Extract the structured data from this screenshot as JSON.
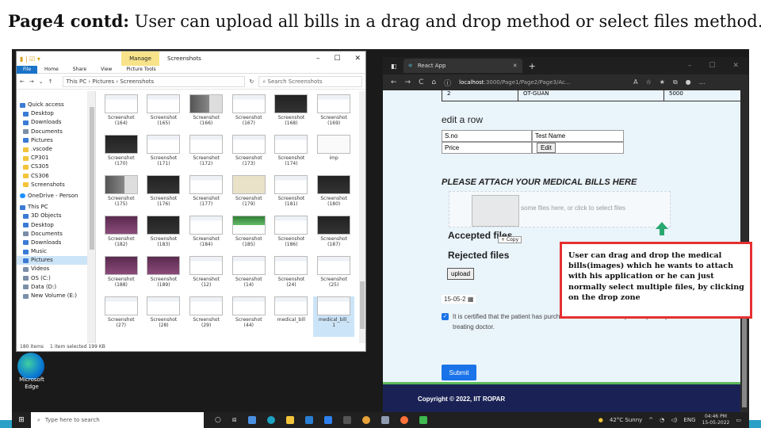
{
  "slide": {
    "title_bold": "Page4 contd:",
    "title_rest": " User can upload all bills in a drag and drop method or select files method."
  },
  "explorer": {
    "manage_tab": "Manage",
    "window_title": "Screenshots",
    "ribbon": [
      "File",
      "Home",
      "Share",
      "View",
      "Picture Tools"
    ],
    "path": "This PC  ›  Pictures  ›  Screenshots",
    "search_placeholder": "Search Screenshots",
    "nav": [
      {
        "label": "Quick access",
        "icon": "star"
      },
      {
        "label": "Desktop",
        "icon": "folder-blue"
      },
      {
        "label": "Downloads",
        "icon": "download"
      },
      {
        "label": "Documents",
        "icon": "documents"
      },
      {
        "label": "Pictures",
        "icon": "pictures"
      },
      {
        "label": ".vscode",
        "icon": "folder"
      },
      {
        "label": "CP301",
        "icon": "folder"
      },
      {
        "label": "CS305",
        "icon": "folder"
      },
      {
        "label": "CS306",
        "icon": "folder"
      },
      {
        "label": "Screenshots",
        "icon": "folder"
      },
      {
        "label": "OneDrive - Person",
        "icon": "cloud"
      },
      {
        "label": "This PC",
        "icon": "pc"
      },
      {
        "label": "3D Objects",
        "icon": "cube"
      },
      {
        "label": "Desktop",
        "icon": "folder-blue"
      },
      {
        "label": "Documents",
        "icon": "documents"
      },
      {
        "label": "Downloads",
        "icon": "download"
      },
      {
        "label": "Music",
        "icon": "music"
      },
      {
        "label": "Pictures",
        "icon": "pictures"
      },
      {
        "label": "Videos",
        "icon": "videos"
      },
      {
        "label": "OS (C:)",
        "icon": "drive"
      },
      {
        "label": "Data (D:)",
        "icon": "drive"
      },
      {
        "label": "New Volume (E:)",
        "icon": "drive"
      }
    ],
    "files": [
      {
        "l1": "Screenshot",
        "l2": "(164)",
        "t": ""
      },
      {
        "l1": "Screenshot",
        "l2": "(165)",
        "t": ""
      },
      {
        "l1": "Screenshot",
        "l2": "(166)",
        "t": "mid"
      },
      {
        "l1": "Screenshot",
        "l2": "(167)",
        "t": ""
      },
      {
        "l1": "Screenshot",
        "l2": "(168)",
        "t": "dark"
      },
      {
        "l1": "Screenshot",
        "l2": "(169)",
        "t": ""
      },
      {
        "l1": "Screenshot",
        "l2": "(170)",
        "t": "dark"
      },
      {
        "l1": "Screenshot",
        "l2": "(171)",
        "t": ""
      },
      {
        "l1": "Screenshot",
        "l2": "(172)",
        "t": ""
      },
      {
        "l1": "Screenshot",
        "l2": "(173)",
        "t": ""
      },
      {
        "l1": "Screenshot",
        "l2": "(174)",
        "t": ""
      },
      {
        "l1": "imp",
        "l2": "",
        "t": "blank"
      },
      {
        "l1": "Screenshot",
        "l2": "(175)",
        "t": "mid"
      },
      {
        "l1": "Screenshot",
        "l2": "(176)",
        "t": "dark"
      },
      {
        "l1": "Screenshot",
        "l2": "(177)",
        "t": ""
      },
      {
        "l1": "Screenshot",
        "l2": "(179)",
        "t": "paper"
      },
      {
        "l1": "Screenshot",
        "l2": "(181)",
        "t": ""
      },
      {
        "l1": "Screenshot",
        "l2": "(180)",
        "t": "dark"
      },
      {
        "l1": "Screenshot",
        "l2": "(182)",
        "t": "purple"
      },
      {
        "l1": "Screenshot",
        "l2": "(183)",
        "t": "dark"
      },
      {
        "l1": "Screenshot",
        "l2": "(184)",
        "t": ""
      },
      {
        "l1": "Screenshot",
        "l2": "(185)",
        "t": "green"
      },
      {
        "l1": "Screenshot",
        "l2": "(186)",
        "t": ""
      },
      {
        "l1": "Screenshot",
        "l2": "(187)",
        "t": "dark"
      },
      {
        "l1": "Screenshot",
        "l2": "(188)",
        "t": "purple"
      },
      {
        "l1": "Screenshot",
        "l2": "(189)",
        "t": "purple"
      },
      {
        "l1": "Screenshot",
        "l2": "(12)",
        "t": ""
      },
      {
        "l1": "Screenshot",
        "l2": "(14)",
        "t": ""
      },
      {
        "l1": "Screenshot",
        "l2": "(24)",
        "t": ""
      },
      {
        "l1": "Screenshot",
        "l2": "(25)",
        "t": ""
      },
      {
        "l1": "Screenshot",
        "l2": "(27)",
        "t": ""
      },
      {
        "l1": "Screenshot",
        "l2": "(28)",
        "t": ""
      },
      {
        "l1": "Screenshot",
        "l2": "(29)",
        "t": ""
      },
      {
        "l1": "Screenshot",
        "l2": "(44)",
        "t": ""
      },
      {
        "l1": "medical_bill",
        "l2": "",
        "t": ""
      },
      {
        "l1": "medical_bill_",
        "l2": "1",
        "t": "",
        "selected": true
      }
    ],
    "status": [
      "180 items",
      "1 item selected  199 KB"
    ]
  },
  "desktop_icon": "Microsoft Edge",
  "browser": {
    "tab_title": "React App",
    "url_host": "localhost",
    "url_rest": ":3000/Page1/Page2/Page3/Ac...",
    "table_partial": [
      "2",
      "OT-GUAN",
      "5000"
    ],
    "edit_row_title": "edit a row",
    "edit_table": {
      "sno_label": "S.no",
      "sno_value": "Test Name",
      "price_label": "Price",
      "edit_button": "Edit"
    },
    "attach_title": "PLEASE ATTACH YOUR MEDICAL BILLS HERE",
    "dropzone_text": "some files here, or click to select files",
    "accepted_label": "Accepted files",
    "copy_badge": "+ Copy",
    "rejected_label": "Rejected files",
    "upload_button": "upload",
    "date_value": "15-05-2",
    "certify_text": "It is certified that the patient has purchased the medicines as per the prescription of the treating doctor.",
    "submit_button": "Submit",
    "footer": "Copyright © 2022, IIT ROPAR"
  },
  "note": "User can drag and drop the medical bills(images) which he wants to attach with his application or he can just normally select multiple files, by clicking on the drop zone",
  "taskbar": {
    "search_placeholder": "Type here to search",
    "weather": "42°C  Sunny",
    "lang": "ENG",
    "time": "04:46 PM",
    "date": "15-05-2022"
  }
}
